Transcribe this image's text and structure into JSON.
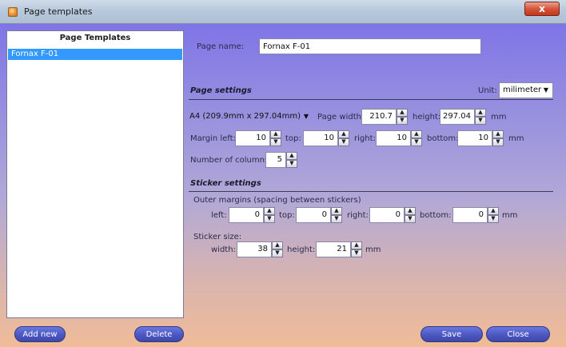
{
  "window": {
    "title": "Page templates",
    "close_symbol": "x"
  },
  "templates_pane": {
    "title": "Page Templates",
    "items": [
      "Fornax F-01"
    ],
    "selected_index": 0
  },
  "page_name": {
    "label": "Page name:",
    "value": "Fornax F-01"
  },
  "page_settings": {
    "heading": "Page settings",
    "unit_label": "Unit:",
    "unit_value": "milimeter",
    "paper_size": "A4 (209.9mm x 297.04mm)",
    "page_width_label": "Page width:",
    "page_width": "210.7",
    "height_label": "height:",
    "height": "297.04",
    "mm": "mm",
    "margin_left_label": "Margin left:",
    "margin_left": "10",
    "top_label": "top:",
    "margin_top": "10",
    "right_label": "right:",
    "margin_right": "10",
    "bottom_label": "bottom:",
    "margin_bottom": "10",
    "columns_label": "Number of columns:",
    "columns": "5"
  },
  "sticker_settings": {
    "heading": "Sticker settings",
    "outer_margins_label": "Outer margins (spacing between stickers)",
    "left_label": "left:",
    "left": "0",
    "top_label": "top:",
    "top": "0",
    "right_label": "right:",
    "right": "0",
    "bottom_label": "bottom:",
    "bottom": "0",
    "mm": "mm",
    "size_label": "Sticker size:",
    "width_label": "width:",
    "width": "38",
    "height_label": "height:",
    "height": "21"
  },
  "buttons": {
    "add_new": "Add new",
    "delete": "Delete",
    "save": "Save",
    "close": "Close"
  }
}
